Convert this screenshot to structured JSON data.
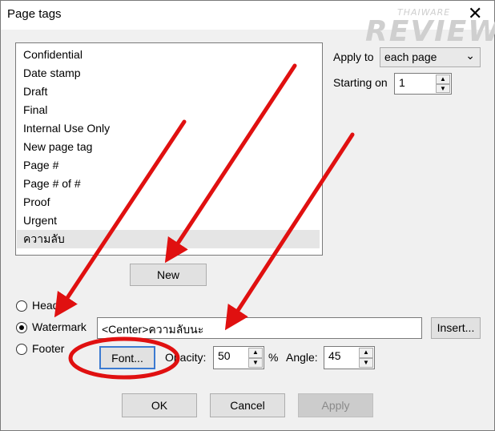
{
  "window": {
    "title": "Page tags"
  },
  "branding": {
    "line1": "THAIWARE",
    "line2": "REVIEW"
  },
  "tag_list": {
    "items": [
      "Confidential",
      "Date stamp",
      "Draft",
      "Final",
      "Internal Use Only",
      "New page tag",
      "Page #",
      "Page # of #",
      "Proof",
      "Urgent",
      "ความลับ"
    ],
    "selected_index": 10
  },
  "apply_to": {
    "label": "Apply to",
    "value": "each page"
  },
  "starting_on": {
    "label": "Starting on",
    "value": "1"
  },
  "buttons": {
    "new": "New",
    "insert": "Insert...",
    "font": "Font...",
    "ok": "OK",
    "cancel": "Cancel",
    "apply": "Apply"
  },
  "position": {
    "header_label": "Head",
    "watermark_label": "Watermark",
    "footer_label": "Footer",
    "selected": "watermark"
  },
  "tag_text": {
    "value": "<Center>ความลับนะ"
  },
  "opacity": {
    "label": "Opacity:",
    "value": "50",
    "unit": "%"
  },
  "angle": {
    "label": "Angle:",
    "value": "45"
  },
  "annotation_color": "#e01010"
}
